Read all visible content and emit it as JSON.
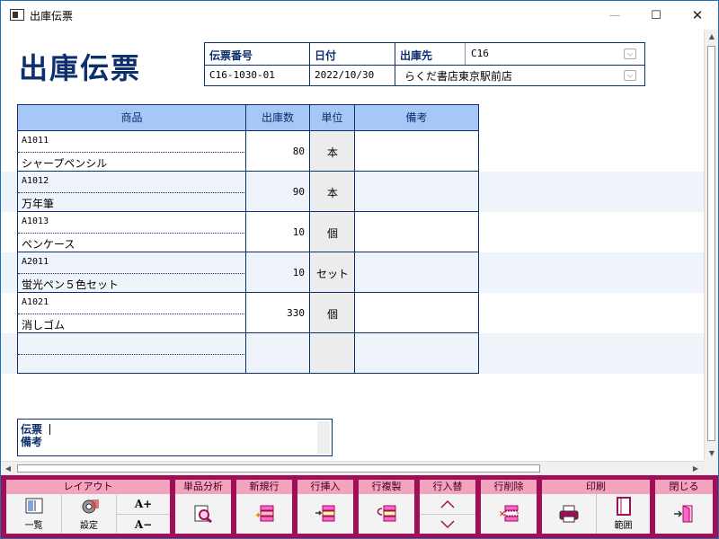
{
  "window": {
    "title": "出庫伝票"
  },
  "doc": {
    "title": "出庫伝票"
  },
  "header": {
    "slip_no_label": "伝票番号",
    "slip_no": "C16-1030-01",
    "date_label": "日付",
    "date": "2022/10/30",
    "dest_label": "出庫先",
    "dest_code": "C16",
    "dest_name": "らくだ書店東京駅前店"
  },
  "grid": {
    "columns": [
      "商品",
      "出庫数",
      "単位",
      "備考"
    ],
    "rows": [
      {
        "code": "A1011",
        "name": "シャープペンシル",
        "qty": "80",
        "unit": "本",
        "memo": ""
      },
      {
        "code": "A1012",
        "name": "万年筆",
        "qty": "90",
        "unit": "本",
        "memo": ""
      },
      {
        "code": "A1013",
        "name": "ペンケース",
        "qty": "10",
        "unit": "個",
        "memo": ""
      },
      {
        "code": "A2011",
        "name": "蛍光ペン５色セット",
        "qty": "10",
        "unit": "セット",
        "memo": ""
      },
      {
        "code": "A1021",
        "name": "消しゴム",
        "qty": "330",
        "unit": "個",
        "memo": ""
      },
      {
        "code": "",
        "name": "",
        "qty": "",
        "unit": "",
        "memo": ""
      }
    ]
  },
  "memo": {
    "label_line1": "伝票",
    "label_line2": "備考",
    "value": ""
  },
  "toolbar": {
    "layout": {
      "label": "レイアウト",
      "list": "一覧",
      "settings": "設定",
      "font_up": "A+",
      "font_down": "A−"
    },
    "product_analysis": {
      "label": "単品分析"
    },
    "new_row": {
      "label": "新規行"
    },
    "insert_row": {
      "label": "行挿入"
    },
    "copy_row": {
      "label": "行複製"
    },
    "swap_row": {
      "label": "行入替"
    },
    "delete_row": {
      "label": "行削除"
    },
    "print": {
      "label": "印刷",
      "range": "範囲"
    },
    "close": {
      "label": "閉じる"
    }
  },
  "colors": {
    "accent": "#0d2f6e",
    "header_fill": "#a7c7f7",
    "toolbar": "#a00e55",
    "toolbar_label": "#f4a3bd"
  }
}
